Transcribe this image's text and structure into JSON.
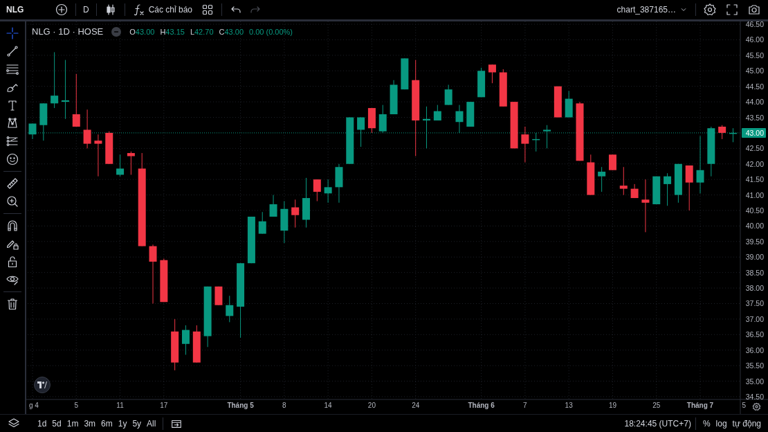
{
  "top_bar": {
    "symbol": "NLG",
    "interval": "D",
    "indicators_label": "Các chỉ báo",
    "undo": {
      "disabled": false
    },
    "redo": {
      "disabled": true
    },
    "layout_name": "chart_387165…"
  },
  "drawing_toolbar": [
    [
      {
        "kind": "crosshair",
        "selected": true
      },
      {
        "kind": "trend-line",
        "selected": false
      },
      {
        "kind": "fib",
        "selected": false
      },
      {
        "kind": "brush",
        "selected": false
      },
      {
        "kind": "text",
        "selected": false
      },
      {
        "kind": "pattern",
        "selected": false
      },
      {
        "kind": "prediction",
        "selected": false
      },
      {
        "kind": "emoji",
        "selected": false
      }
    ],
    [
      {
        "kind": "ruler",
        "selected": false
      },
      {
        "kind": "zoom-in",
        "selected": false
      }
    ],
    [
      {
        "kind": "magnet",
        "selected": false
      },
      {
        "kind": "lock-drawing",
        "selected": false
      },
      {
        "kind": "lock",
        "selected": false
      },
      {
        "kind": "eye",
        "selected": false
      }
    ],
    [
      {
        "kind": "trash",
        "selected": false
      }
    ]
  ],
  "legend": {
    "title": "NLG · 1D · HOSE",
    "fields": [
      {
        "key": "O",
        "value": "43.00"
      },
      {
        "key": "H",
        "value": "43.15"
      },
      {
        "key": "L",
        "value": "42.70"
      },
      {
        "key": "C",
        "value": "43.00"
      }
    ],
    "change": "0.00 (0.00%)"
  },
  "chart": {
    "date_labels_bold": [
      false,
      false,
      false,
      false,
      true,
      false,
      false,
      false,
      false,
      true,
      false,
      false,
      false,
      false,
      true,
      false
    ],
    "chart_data": {
      "type": "candlestick",
      "grid": true,
      "ylim": [
        34.41,
        46.59
      ],
      "categories": [
        "g 4",
        null,
        null,
        null,
        "5",
        null,
        null,
        null,
        "11",
        null,
        null,
        null,
        "17",
        null,
        null,
        null,
        null,
        null,
        null,
        "Tháng 5",
        null,
        null,
        null,
        "8",
        null,
        null,
        null,
        "14",
        null,
        null,
        null,
        "20",
        null,
        null,
        null,
        "24",
        null,
        null,
        null,
        null,
        null,
        "Tháng 6",
        null,
        null,
        null,
        "7",
        null,
        null,
        null,
        "13",
        null,
        null,
        null,
        "19",
        null,
        null,
        null,
        "25",
        null,
        null,
        null,
        "Tháng 7",
        null,
        null,
        null,
        "5"
      ],
      "ohlc": [
        [
          42.95,
          43.3,
          42.8,
          43.3
        ],
        [
          43.25,
          43.95,
          42.75,
          43.95
        ],
        [
          43.95,
          45.6,
          43.8,
          44.2
        ],
        [
          44.0,
          45.35,
          43.45,
          44.05
        ],
        [
          43.6,
          44.9,
          43.2,
          43.2
        ],
        [
          43.1,
          43.75,
          42.5,
          42.65
        ],
        [
          42.75,
          42.95,
          41.6,
          42.65
        ],
        [
          43.0,
          43.05,
          42.0,
          42.0
        ],
        [
          41.65,
          42.3,
          41.6,
          41.85
        ],
        [
          42.35,
          42.4,
          41.65,
          42.25
        ],
        [
          41.85,
          42.35,
          39.35,
          39.35
        ],
        [
          39.35,
          39.4,
          37.5,
          38.85
        ],
        [
          38.9,
          38.95,
          37.55,
          37.55
        ],
        [
          36.6,
          37.0,
          35.35,
          35.6
        ],
        [
          36.2,
          36.8,
          35.85,
          36.65
        ],
        [
          36.6,
          36.8,
          35.6,
          35.6
        ],
        [
          36.45,
          38.05,
          36.1,
          38.05
        ],
        [
          38.05,
          38.05,
          37.45,
          37.45
        ],
        [
          37.1,
          37.75,
          36.9,
          37.45
        ],
        [
          37.4,
          38.8,
          36.4,
          38.8
        ],
        [
          38.8,
          40.3,
          38.8,
          40.3
        ],
        [
          39.75,
          40.45,
          39.75,
          40.15
        ],
        [
          40.3,
          41.0,
          40.3,
          40.7
        ],
        [
          39.85,
          40.8,
          39.45,
          40.55
        ],
        [
          40.6,
          40.85,
          39.95,
          40.35
        ],
        [
          40.2,
          41.55,
          39.95,
          40.9
        ],
        [
          41.5,
          41.5,
          40.8,
          41.1
        ],
        [
          41.05,
          41.5,
          40.75,
          41.25
        ],
        [
          41.25,
          42.0,
          40.75,
          41.9
        ],
        [
          42.0,
          43.5,
          42.0,
          43.5
        ],
        [
          43.1,
          43.5,
          42.55,
          43.5
        ],
        [
          43.8,
          43.8,
          43.0,
          43.15
        ],
        [
          43.05,
          43.9,
          43.0,
          43.6
        ],
        [
          43.6,
          44.7,
          43.6,
          44.55
        ],
        [
          44.4,
          45.4,
          44.4,
          45.4
        ],
        [
          44.7,
          45.35,
          42.25,
          43.4
        ],
        [
          43.4,
          43.85,
          42.5,
          43.45
        ],
        [
          43.4,
          43.9,
          43.4,
          43.7
        ],
        [
          43.9,
          44.55,
          43.9,
          44.4
        ],
        [
          43.35,
          43.9,
          43.0,
          43.7
        ],
        [
          43.2,
          44.0,
          43.2,
          44.0
        ],
        [
          44.15,
          45.1,
          44.15,
          45.0
        ],
        [
          45.2,
          45.2,
          44.6,
          44.95
        ],
        [
          44.95,
          45.05,
          43.85,
          43.85
        ],
        [
          44.0,
          44.0,
          42.5,
          42.5
        ],
        [
          42.95,
          43.2,
          42.05,
          42.65
        ],
        [
          42.8,
          43.0,
          42.4,
          42.8
        ],
        [
          43.05,
          43.25,
          42.5,
          43.1
        ],
        [
          44.5,
          44.5,
          43.5,
          43.5
        ],
        [
          43.5,
          44.35,
          43.5,
          44.1
        ],
        [
          43.95,
          44.0,
          42.1,
          42.1
        ],
        [
          42.05,
          42.3,
          41.0,
          41.0
        ],
        [
          41.6,
          41.9,
          41.1,
          41.75
        ],
        [
          42.3,
          42.3,
          41.8,
          41.8
        ],
        [
          41.3,
          41.9,
          41.0,
          41.2
        ],
        [
          41.2,
          41.35,
          40.9,
          40.9
        ],
        [
          40.85,
          41.5,
          39.8,
          40.75
        ],
        [
          40.7,
          41.6,
          40.7,
          41.6
        ],
        [
          41.35,
          41.7,
          40.65,
          41.6
        ],
        [
          41.0,
          42.0,
          40.75,
          42.0
        ],
        [
          41.95,
          41.95,
          40.5,
          41.4
        ],
        [
          41.4,
          42.9,
          41.05,
          41.8
        ],
        [
          42.0,
          43.2,
          41.6,
          43.15
        ],
        [
          43.2,
          43.25,
          42.8,
          43.0
        ],
        [
          43.0,
          43.15,
          42.7,
          43.0
        ],
        null
      ],
      "ref_lines": [
        {
          "axis": "y",
          "value": 43.0,
          "label": "43.00",
          "color": "#089981"
        }
      ],
      "yticks": [
        {
          "value": 46.5,
          "label": "46.50"
        },
        {
          "value": 46,
          "label": "46.00"
        },
        {
          "value": 45.5,
          "label": "45.50"
        },
        {
          "value": 45,
          "label": "45.00"
        },
        {
          "value": 44.5,
          "label": "44.50"
        },
        {
          "value": 44,
          "label": "44.00"
        },
        {
          "value": 43.5,
          "label": "43.50"
        },
        {
          "value": 42.5,
          "label": "42.50"
        },
        {
          "value": 42,
          "label": "42.00"
        },
        {
          "value": 41.5,
          "label": "41.50"
        },
        {
          "value": 41,
          "label": "41.00"
        },
        {
          "value": 40.5,
          "label": "40.50"
        },
        {
          "value": 40,
          "label": "40.00"
        },
        {
          "value": 39.5,
          "label": "39.50"
        },
        {
          "value": 39,
          "label": "39.00"
        },
        {
          "value": 38.5,
          "label": "38.50"
        },
        {
          "value": 38,
          "label": "38.00"
        },
        {
          "value": 37.5,
          "label": "37.50"
        },
        {
          "value": 37,
          "label": "37.00"
        },
        {
          "value": 36.5,
          "label": "36.50"
        },
        {
          "value": 36,
          "label": "36.00"
        },
        {
          "value": 35.5,
          "label": "35.50"
        },
        {
          "value": 35,
          "label": "35.00"
        },
        {
          "value": 34.5,
          "label": "34.50"
        }
      ]
    }
  },
  "bottom_bar": {
    "ranges": [
      "1d",
      "5d",
      "1m",
      "3m",
      "6m",
      "1y",
      "5y",
      "All"
    ],
    "clock": "18:24:45 (UTC+7)",
    "scale_options": [
      "%",
      "log",
      "tự động"
    ]
  }
}
